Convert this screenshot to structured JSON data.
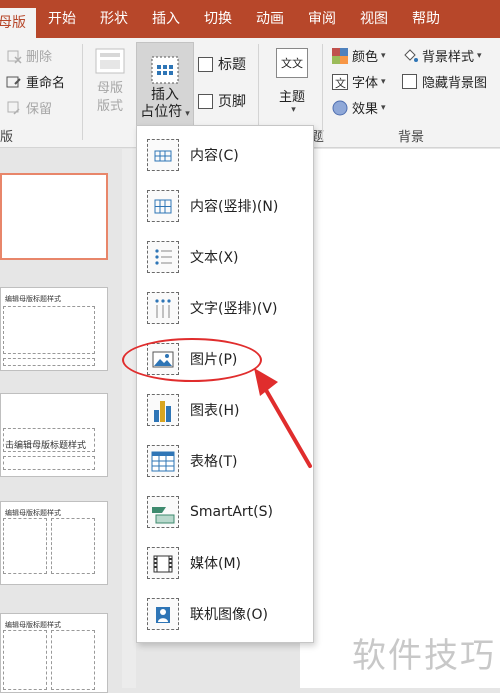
{
  "tabs": [
    "母版",
    "开始",
    "形状",
    "插入",
    "切换",
    "动画",
    "审阅",
    "视图",
    "帮助"
  ],
  "ribbon": {
    "delete_label": "删除",
    "rename_label": "重命名",
    "preserve_label": "保留",
    "group_left_label": "版",
    "master_layout_label": "母版\n版式",
    "master_layout_line1": "母版",
    "master_layout_line2": "版式",
    "insert_placeholder_line1": "插入",
    "insert_placeholder_line2": "占位符",
    "title_checkbox": "标题",
    "footer_checkbox": "页脚",
    "theme_label": "主题",
    "theme_icon_text": "文文",
    "colors_label": "颜色",
    "fonts_label": "字体",
    "effects_label": "效果",
    "bg_styles_label": "背景样式",
    "hide_bg_label": "隐藏背景图",
    "group_theme_suffix": "题",
    "group_background_label": "背景"
  },
  "thumbs": [
    {
      "title": ""
    },
    {
      "title": "编辑母版标题样式"
    },
    {
      "title": "击编辑母版标题样式"
    },
    {
      "title": "编辑母版标题样式"
    },
    {
      "title": "编辑母版标题样式"
    }
  ],
  "dropdown": {
    "items": [
      {
        "label": "内容(C)",
        "icon": "content-icon"
      },
      {
        "label": "内容(竖排)(N)",
        "icon": "content-vertical-icon"
      },
      {
        "label": "文本(X)",
        "icon": "text-icon"
      },
      {
        "label": "文字(竖排)(V)",
        "icon": "text-vertical-icon"
      },
      {
        "label": "图片(P)",
        "icon": "picture-icon"
      },
      {
        "label": "图表(H)",
        "icon": "chart-icon"
      },
      {
        "label": "表格(T)",
        "icon": "table-icon"
      },
      {
        "label": "SmartArt(S)",
        "icon": "smartart-icon"
      },
      {
        "label": "媒体(M)",
        "icon": "media-icon"
      },
      {
        "label": "联机图像(O)",
        "icon": "online-image-icon"
      }
    ]
  },
  "watermark": "软件技巧",
  "colors": {
    "accent": "#b7472a",
    "highlight": "#e02d2d"
  }
}
